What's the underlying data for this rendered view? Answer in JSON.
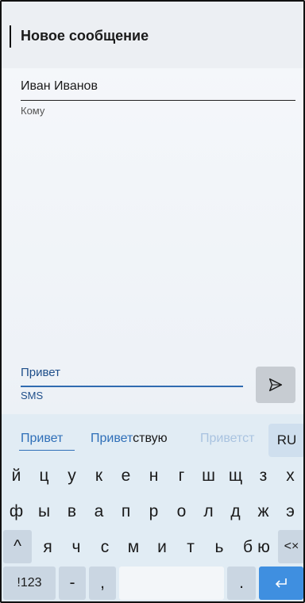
{
  "header": {
    "title": "Новое сообщение"
  },
  "recipient": {
    "value": "Иван Иванов",
    "label": "Кому"
  },
  "message": {
    "value": "Привет",
    "label": "SMS"
  },
  "send": {
    "icon": "send-icon"
  },
  "keyboard": {
    "suggestions": [
      {
        "match": "Привет",
        "rest": ""
      },
      {
        "match": "Привет",
        "rest": "ствую"
      },
      {
        "match": "Приветс",
        "rest": "т"
      }
    ],
    "language": "RU",
    "row1": [
      "й",
      "ц",
      "у",
      "к",
      "е",
      "н",
      "г",
      "ш",
      "щ",
      "з",
      "х"
    ],
    "row2": [
      "ф",
      "ы",
      "в",
      "а",
      "п",
      "р",
      "о",
      "л",
      "д",
      "ж",
      "э"
    ],
    "row3": [
      "я",
      "ч",
      "с",
      "м",
      "и",
      "т",
      "ь",
      "б",
      "ю"
    ],
    "shift_icon": "^",
    "backspace_icon": "<×",
    "numbers_label": "!123",
    "dash_label": "-",
    "comma_label": ",",
    "period_label": ".",
    "enter_icon": "enter-icon"
  },
  "colors": {
    "accent": "#2f6fb8",
    "enter": "#3f8fe0",
    "keyboard_bg": "#e1ecf4"
  }
}
